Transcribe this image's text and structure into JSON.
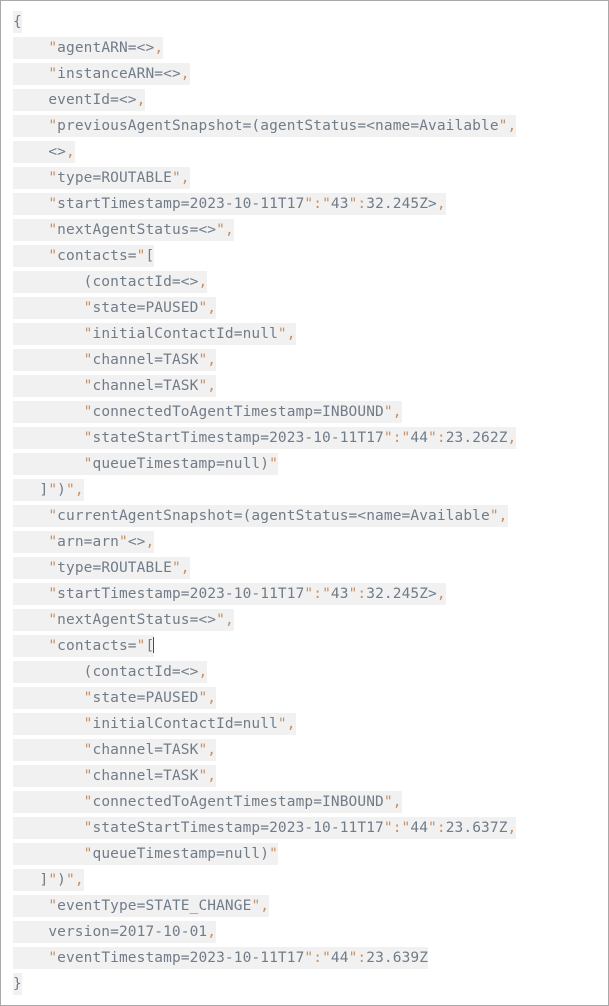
{
  "viewer": {
    "name": "agent-event-json-payload",
    "background_color": "#ffffff",
    "border_color": "#a9a9a9",
    "line_highlight_color": "#f1f1f1",
    "text_color": "#717c89",
    "punctuation_color": "#c79064"
  },
  "code": {
    "indent_unit": "    ",
    "lines": [
      {
        "indent": 0,
        "text": "{"
      },
      {
        "indent": 1,
        "text": "\"agentARN=<>,"
      },
      {
        "indent": 1,
        "text": "\"instanceARN=<>,"
      },
      {
        "indent": 1,
        "text": "eventId=<>,"
      },
      {
        "indent": 1,
        "text": "\"previousAgentSnapshot=(agentStatus=<name=Available\","
      },
      {
        "indent": 1,
        "text": "<>,"
      },
      {
        "indent": 1,
        "text": "\"type=ROUTABLE\","
      },
      {
        "indent": 1,
        "text": "\"startTimestamp=2023-10-11T17\":\"43\":32.245Z>,"
      },
      {
        "indent": 1,
        "text": "\"nextAgentStatus=<>\","
      },
      {
        "indent": 1,
        "text": "\"contacts=\"["
      },
      {
        "indent": 2,
        "text": "(contactId=<>,"
      },
      {
        "indent": 2,
        "text": "\"state=PAUSED\","
      },
      {
        "indent": 2,
        "text": "\"initialContactId=null\","
      },
      {
        "indent": 2,
        "text": "\"channel=TASK\","
      },
      {
        "indent": 2,
        "text": "\"channel=TASK\","
      },
      {
        "indent": 2,
        "text": "\"connectedToAgentTimestamp=INBOUND\","
      },
      {
        "indent": 2,
        "text": "\"stateStartTimestamp=2023-10-11T17\":\"44\":23.262Z,"
      },
      {
        "indent": 2,
        "text": "\"queueTimestamp=null)\""
      },
      {
        "indent": 0,
        "text": "   ]\")\","
      },
      {
        "indent": 1,
        "text": "\"currentAgentSnapshot=(agentStatus=<name=Available\","
      },
      {
        "indent": 1,
        "text": "\"arn=arn\"<>,"
      },
      {
        "indent": 1,
        "text": "\"type=ROUTABLE\","
      },
      {
        "indent": 1,
        "text": "\"startTimestamp=2023-10-11T17\":\"43\":32.245Z>,"
      },
      {
        "indent": 1,
        "text": "\"nextAgentStatus=<>\","
      },
      {
        "indent": 1,
        "text": "\"contacts=\"[",
        "caret_after": true
      },
      {
        "indent": 2,
        "text": "(contactId=<>,"
      },
      {
        "indent": 2,
        "text": "\"state=PAUSED\","
      },
      {
        "indent": 2,
        "text": "\"initialContactId=null\","
      },
      {
        "indent": 2,
        "text": "\"channel=TASK\","
      },
      {
        "indent": 2,
        "text": "\"channel=TASK\","
      },
      {
        "indent": 2,
        "text": "\"connectedToAgentTimestamp=INBOUND\","
      },
      {
        "indent": 2,
        "text": "\"stateStartTimestamp=2023-10-11T17\":\"44\":23.637Z,"
      },
      {
        "indent": 2,
        "text": "\"queueTimestamp=null)\""
      },
      {
        "indent": 0,
        "text": "   ]\")\","
      },
      {
        "indent": 1,
        "text": "\"eventType=STATE_CHANGE\","
      },
      {
        "indent": 1,
        "text": "version=2017-10-01,"
      },
      {
        "indent": 1,
        "text": "\"eventTimestamp=2023-10-11T17\":\"44\":23.639Z"
      },
      {
        "indent": 0,
        "text": "}"
      }
    ]
  }
}
